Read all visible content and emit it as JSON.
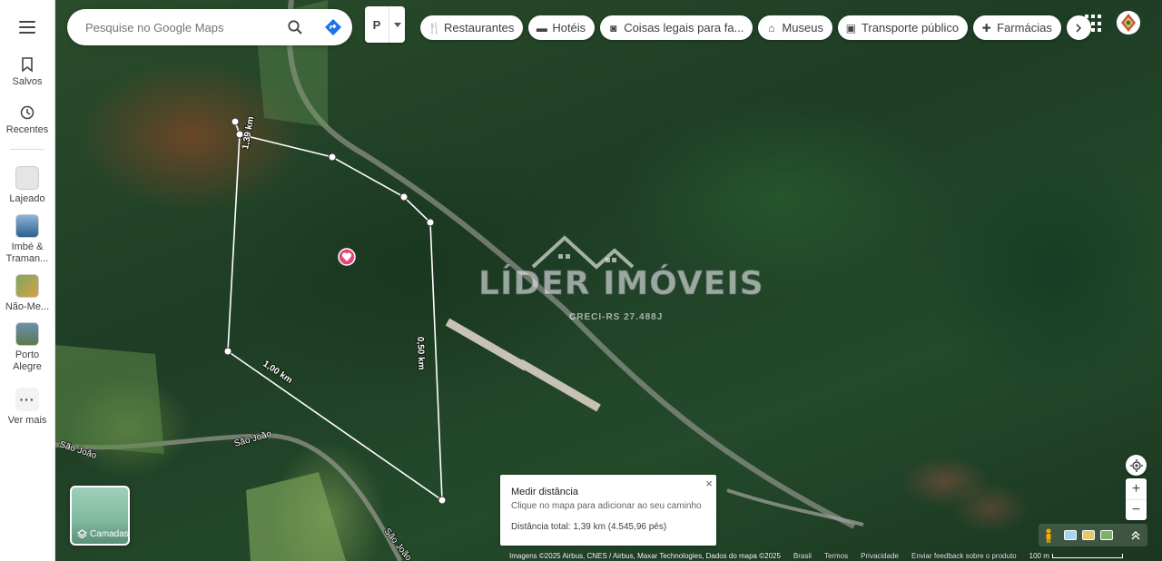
{
  "search": {
    "placeholder": "Pesquise no Google Maps"
  },
  "parking_button": {
    "label": "P"
  },
  "chips": [
    {
      "icon": "restaurant-icon",
      "label": "Restaurantes"
    },
    {
      "icon": "hotel-icon",
      "label": "Hotéis"
    },
    {
      "icon": "camera-icon",
      "label": "Coisas legais para fa..."
    },
    {
      "icon": "museum-icon",
      "label": "Museus"
    },
    {
      "icon": "transit-icon",
      "label": "Transporte público"
    },
    {
      "icon": "pharmacy-icon",
      "label": "Farmácias"
    }
  ],
  "sidebar": {
    "saved_label": "Salvos",
    "recents_label": "Recentes",
    "places": [
      {
        "label": "Lajeado"
      },
      {
        "label": "Imbé &\nTraman..."
      },
      {
        "label": "Não-Me..."
      },
      {
        "label": "Porto\nAlegre"
      }
    ],
    "more_label": "Ver mais"
  },
  "layers": {
    "label": "Camadas"
  },
  "watermark": {
    "title": "LÍDER IMÓVEIS",
    "subtitle": "CRECI-RS 27.488J"
  },
  "map_labels": {
    "road_1": "São João",
    "road_2": "São João",
    "road_3": "São João",
    "dist_1": "1,39 km",
    "dist_2": "0,50 km",
    "dist_3": "1,00 km"
  },
  "measure": {
    "title": "Medir distância",
    "hint": "Clique no mapa para adicionar ao seu caminho",
    "total": "Distância total: 1,39 km (4.545,96 pés)",
    "close": "×"
  },
  "footer": {
    "imagery": "Imagens ©2025 Airbus, CNES / Airbus, Maxar Technologies, Dados do mapa ©2025",
    "country": "Brasil",
    "terms": "Termos",
    "privacy": "Privacidade",
    "feedback": "Enviar feedback sobre o produto",
    "scale": "100 m"
  },
  "colors": {
    "accent_blue": "#1a73e8",
    "pin": "#e8437a"
  }
}
